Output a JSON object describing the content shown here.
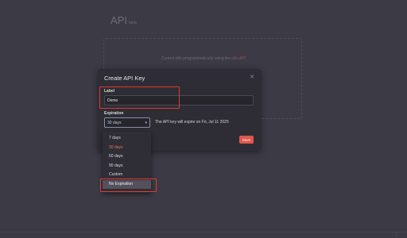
{
  "background_page": {
    "title": "API",
    "subtitle": "beta",
    "description": "Control n8n programmatically using the",
    "description_link": "n8n API"
  },
  "modal": {
    "title": "Create API Key",
    "close_icon": "close-icon",
    "label_field": {
      "label": "Label",
      "value": "Demo"
    },
    "expiration_field": {
      "label": "Expiration",
      "selected": "30 days",
      "note": "The API key will expire on Fri, Jul 11 2025"
    },
    "save_label": "Save"
  },
  "dropdown": {
    "options": [
      {
        "label": "7 days"
      },
      {
        "label": "30 days"
      },
      {
        "label": "60 days"
      },
      {
        "label": "90 days"
      },
      {
        "label": "Custom"
      },
      {
        "label": "No Expiration"
      }
    ],
    "selected_option": "30 days",
    "hovered_option": "No Expiration"
  },
  "colors": {
    "accent": "#e0574d",
    "highlight": "#e03a2e",
    "selected_option": "#e8705e"
  }
}
